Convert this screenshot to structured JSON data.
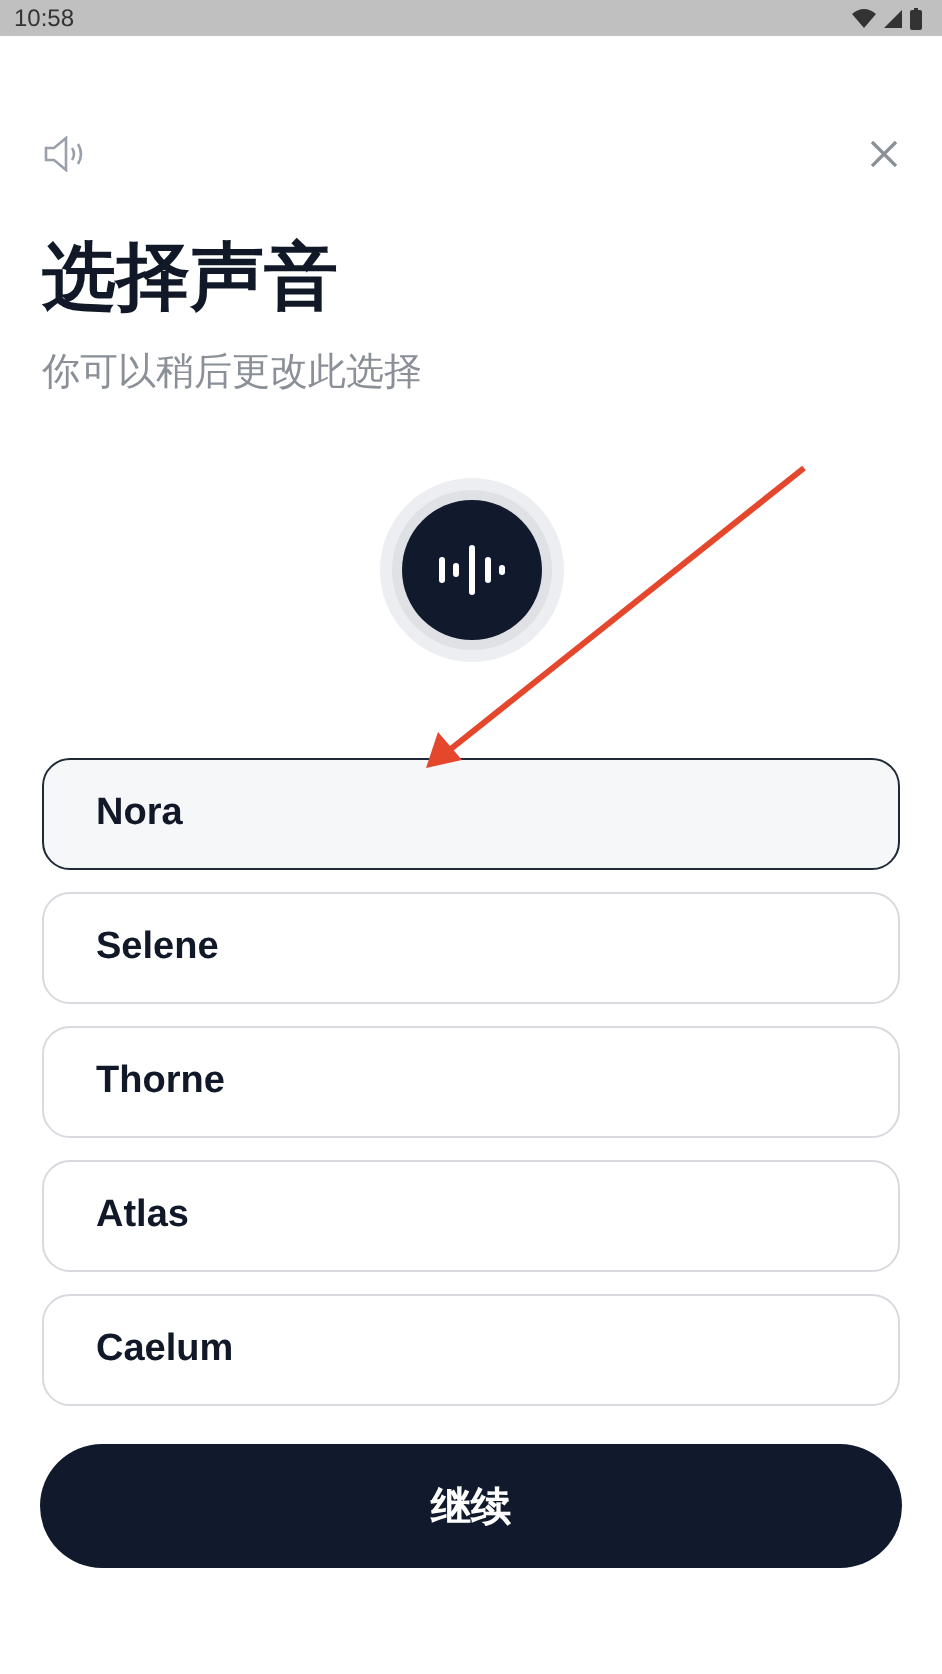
{
  "status_bar": {
    "time": "10:58"
  },
  "title": "选择声音",
  "subtitle": "你可以稍后更改此选择",
  "voices": [
    {
      "name": "Nora",
      "selected": true
    },
    {
      "name": "Selene",
      "selected": false
    },
    {
      "name": "Thorne",
      "selected": false
    },
    {
      "name": "Atlas",
      "selected": false
    },
    {
      "name": "Caelum",
      "selected": false
    }
  ],
  "continue_button": "继续"
}
